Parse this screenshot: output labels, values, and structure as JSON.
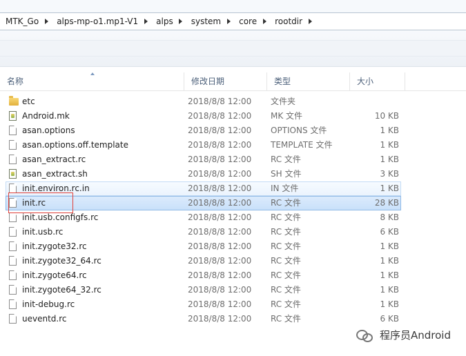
{
  "breadcrumb": [
    "MTK_Go",
    "alps-mp-o1.mp1-V1",
    "alps",
    "system",
    "core",
    "rootdir"
  ],
  "columns": {
    "name": "名称",
    "date": "修改日期",
    "type": "类型",
    "size": "大小"
  },
  "files": [
    {
      "name": "etc",
      "date": "2018/8/8 12:00",
      "type": "文件夹",
      "size": "",
      "icon": "folder-icon"
    },
    {
      "name": "Android.mk",
      "date": "2018/8/8 12:00",
      "type": "MK 文件",
      "size": "10 KB",
      "icon": "script-file-icon"
    },
    {
      "name": "asan.options",
      "date": "2018/8/8 12:00",
      "type": "OPTIONS 文件",
      "size": "1 KB",
      "icon": "file-icon"
    },
    {
      "name": "asan.options.off.template",
      "date": "2018/8/8 12:00",
      "type": "TEMPLATE 文件",
      "size": "1 KB",
      "icon": "file-icon"
    },
    {
      "name": "asan_extract.rc",
      "date": "2018/8/8 12:00",
      "type": "RC 文件",
      "size": "1 KB",
      "icon": "file-icon"
    },
    {
      "name": "asan_extract.sh",
      "date": "2018/8/8 12:00",
      "type": "SH 文件",
      "size": "3 KB",
      "icon": "script-file-icon"
    },
    {
      "name": "init.environ.rc.in",
      "date": "2018/8/8 12:00",
      "type": "IN 文件",
      "size": "1 KB",
      "icon": "file-icon",
      "state": "hover"
    },
    {
      "name": "init.rc",
      "date": "2018/8/8 12:00",
      "type": "RC 文件",
      "size": "28 KB",
      "icon": "file-icon",
      "state": "selected"
    },
    {
      "name": "init.usb.configfs.rc",
      "date": "2018/8/8 12:00",
      "type": "RC 文件",
      "size": "8 KB",
      "icon": "file-icon"
    },
    {
      "name": "init.usb.rc",
      "date": "2018/8/8 12:00",
      "type": "RC 文件",
      "size": "6 KB",
      "icon": "file-icon"
    },
    {
      "name": "init.zygote32.rc",
      "date": "2018/8/8 12:00",
      "type": "RC 文件",
      "size": "1 KB",
      "icon": "file-icon"
    },
    {
      "name": "init.zygote32_64.rc",
      "date": "2018/8/8 12:00",
      "type": "RC 文件",
      "size": "1 KB",
      "icon": "file-icon"
    },
    {
      "name": "init.zygote64.rc",
      "date": "2018/8/8 12:00",
      "type": "RC 文件",
      "size": "1 KB",
      "icon": "file-icon"
    },
    {
      "name": "init.zygote64_32.rc",
      "date": "2018/8/8 12:00",
      "type": "RC 文件",
      "size": "1 KB",
      "icon": "file-icon"
    },
    {
      "name": "init-debug.rc",
      "date": "2018/8/8 12:00",
      "type": "RC 文件",
      "size": "1 KB",
      "icon": "file-icon"
    },
    {
      "name": "ueventd.rc",
      "date": "2018/8/8 12:00",
      "type": "RC 文件",
      "size": "6 KB",
      "icon": "file-icon"
    }
  ],
  "watermark": {
    "text": "程序员Android",
    "icon": "wechat-icon"
  },
  "colors": {
    "selection": "#c8e0fa",
    "selection_border": "#8fb9e6",
    "annotation": "#e0403a",
    "header_text": "#4c607a"
  }
}
